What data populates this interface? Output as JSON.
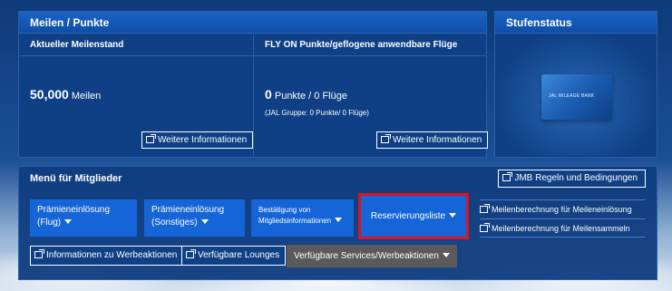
{
  "miles_panel": {
    "title": "Meilen / Punkte",
    "left": {
      "title": "Aktueller Meilenstand",
      "value": "50,000",
      "unit": "Meilen",
      "more": "Weitere Informationen"
    },
    "right": {
      "title": "FLY ON Punkte/geflogene anwendbare Flüge",
      "value": "0",
      "unit": "Punkte / 0 Flüge",
      "note": "(JAL Gruppe: 0 Punkte/ 0 Flüge)",
      "more": "Weitere Informationen"
    }
  },
  "status_panel": {
    "title": "Stufenstatus",
    "card_text": "JAL MILEAGE BANK"
  },
  "menu": {
    "title": "Menü für Mitglieder",
    "jmb_rules": "JMB Regeln und Bedingungen",
    "buttons": [
      {
        "line1": "Prämieneinlösung",
        "line2": "(Flug)"
      },
      {
        "line1": "Prämieneinlösung",
        "line2": "(Sonstiges)"
      },
      {
        "line1": "Bestätigung von",
        "line2": "Mitgliedsinformationen"
      },
      {
        "line1": "Reservierungsliste"
      }
    ],
    "side_links": [
      "Meilenberechnung für Meileneinlösung",
      "Meilenberechnung für Meilensammeln"
    ],
    "bottom": {
      "promotions": "Informationen zu Werbeaktionen",
      "lounges": "Verfügbare Lounges",
      "services": "Verfügbare Services/Werbeaktionen"
    }
  },
  "colors": {
    "panel": "#0f3f85",
    "button": "#1565d8",
    "highlight": "#e0121a",
    "grey_button": "#5a5a5a"
  }
}
